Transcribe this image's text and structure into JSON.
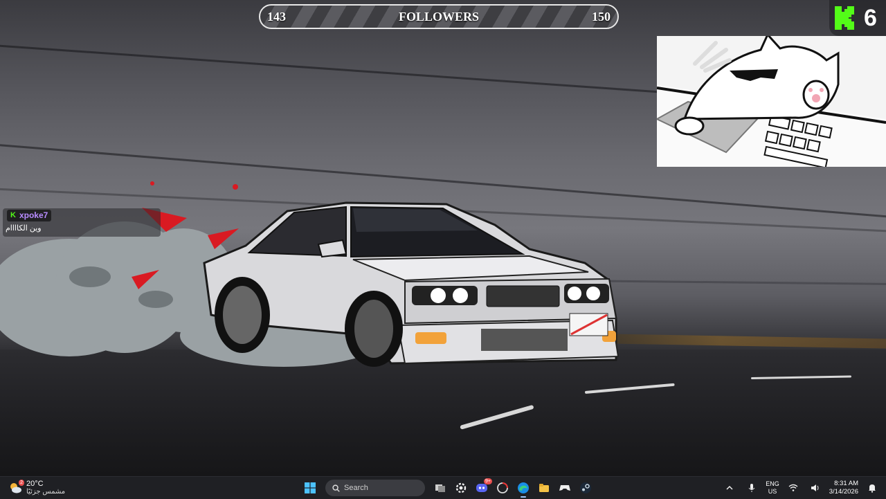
{
  "overlay": {
    "followers": {
      "current": "143",
      "label": "FOLLOWERS",
      "goal": "150",
      "progress_fraction": 0.0
    },
    "kick_viewers": {
      "count": "6",
      "accent": "#53fc18"
    }
  },
  "chat": {
    "messages": [
      {
        "username": "xpoke7",
        "platform_icon": "kick-icon",
        "text": "وين الكاااام"
      }
    ]
  },
  "taskbar": {
    "weather": {
      "temperature": "20°C",
      "condition": "مشمس جزئيًا",
      "alerts": "2"
    },
    "search_placeholder": "Search",
    "pinned": [
      {
        "name": "windows-start-icon"
      },
      {
        "name": "search-box"
      },
      {
        "name": "task-view-icon"
      },
      {
        "name": "settings-gear-icon"
      },
      {
        "name": "discord-icon",
        "badge": "9+"
      },
      {
        "name": "chrome-like-icon",
        "badge": ""
      },
      {
        "name": "edge-icon",
        "active": true
      },
      {
        "name": "file-explorer-icon"
      },
      {
        "name": "gamepad-icon"
      },
      {
        "name": "steam-icon"
      }
    ],
    "tray": {
      "language": "ENG",
      "region": "US",
      "time": "8:31 AM",
      "date": "3/14/2026"
    }
  }
}
